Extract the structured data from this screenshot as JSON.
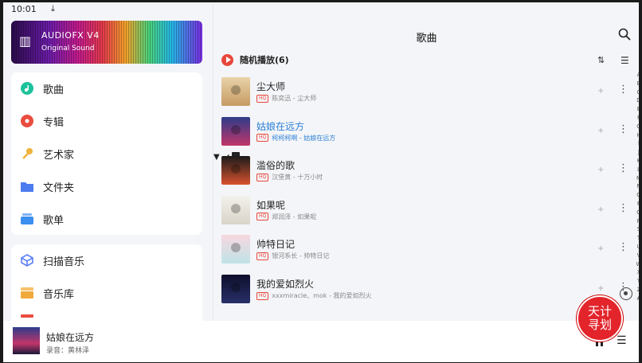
{
  "status": {
    "time": "10:01"
  },
  "banner": {
    "title": "AUDIOFX V4",
    "subtitle": "Original Sound"
  },
  "nav_main": [
    {
      "label": "歌曲",
      "icon": "music-note-icon",
      "color": "#1bc29b"
    },
    {
      "label": "专辑",
      "icon": "album-icon",
      "color": "#ea4d3f"
    },
    {
      "label": "艺术家",
      "icon": "microphone-icon",
      "color": "#f0b23a"
    },
    {
      "label": "文件夹",
      "icon": "folder-icon",
      "color": "#4d7cf0"
    },
    {
      "label": "歌单",
      "icon": "playlist-icon",
      "color": "#3b8ff0"
    }
  ],
  "nav_tools": [
    {
      "label": "扫描音乐",
      "icon": "scan-cube-icon",
      "color": "#5b7ff5"
    },
    {
      "label": "音乐库",
      "icon": "library-icon",
      "color": "#f2a93b"
    }
  ],
  "header": {
    "title": "歌曲"
  },
  "shuffle": {
    "label": "随机播放(6)"
  },
  "songs": [
    {
      "title": "尘大师",
      "artist": "陈奕迅 - 尘大师",
      "badge": "HQ"
    },
    {
      "title": "姑娘在远方",
      "artist": "柯柯柯啊 - 姑娘在远方",
      "badge": "HQ",
      "active": true
    },
    {
      "title": "滥俗的歌",
      "artist": "汉堡黄 - 十万小时",
      "badge": "HQ"
    },
    {
      "title": "如果呢",
      "artist": "郑润泽 - 如果呢",
      "badge": "HQ"
    },
    {
      "title": "帅特日记",
      "artist": "银河系长 - 帅特日记",
      "badge": "HQ"
    },
    {
      "title": "我的爱如烈火",
      "artist": "xxxmiracle、mok - 我的爱如烈火",
      "badge": "HQ"
    }
  ],
  "alphabet": [
    "A",
    "B",
    "C",
    "D",
    "E",
    "F",
    "G",
    "H",
    "I",
    "J",
    "K",
    "L",
    "M",
    "N",
    "O",
    "P",
    "Q",
    "R",
    "S",
    "T",
    "U",
    "V",
    "W",
    "X",
    "Y",
    "Z",
    "#"
  ],
  "player": {
    "title": "姑娘在远方",
    "subtitle": "录音：黄林泽"
  },
  "watermark": {
    "line1": "天计",
    "line2": "寻划"
  },
  "colors": {
    "accent": "#e8473b",
    "active_song": "#2a7fd6"
  }
}
